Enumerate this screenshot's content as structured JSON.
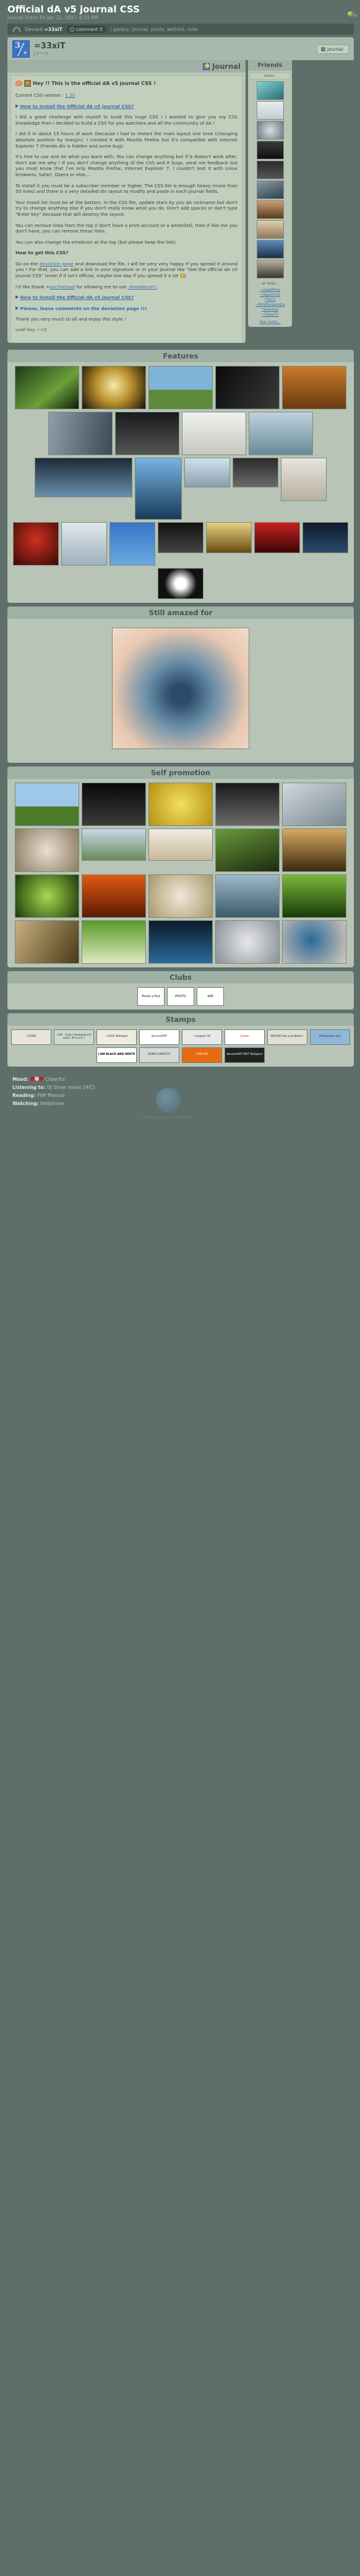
{
  "header": {
    "title": "Official dA v5 journal CSS",
    "subtitle": "Journal Entry: Fri Jan 12, 2007, 6:15 PM"
  },
  "nav": {
    "logo_icon": "deviantart-logo-icon",
    "deviant_label": "Deviant",
    "deviant_name": "=33xiT",
    "comment_label": "comment it",
    "comment_icon": "comment-icon",
    "separator": "|",
    "links": [
      "gallery",
      "journal",
      "prints",
      "wishlist",
      "note"
    ]
  },
  "user": {
    "avatar_icon": "user-avatar",
    "username": "=33xiT",
    "realname": "Joris",
    "button_label": "Journal",
    "button_icon": "journal-icon"
  },
  "journal": {
    "heading": "Journal",
    "heading_icon": "journal-write-icon",
    "greeting": "Hey !! This is the official dA v5 journal CSS !",
    "greeting_icons": [
      "emoticon-icon",
      "picture-frame-icon"
    ],
    "version_label": "Current CSS version :",
    "version_value": "1.20",
    "install_link": "How to install the Official dA v5 journal CSS?",
    "install_icon": "arrow-bullet-icon",
    "paragraphs": [
      "I did a great challenge with myself to build this huge CSS ! I wanted to give you my CSS knowledge then I decided to build a CSS for you watchers and all the community of dA !",
      "I did it in about 15 hours of work (because I had to restart the main layout one time (changing absolute position by margin), I created it with Mozilla Firefox but it's compatible with Internet Explorer 7 (friends div is hidden and some bug).",
      "It's free to use and do what you want with. You can change anything but if it doesn't work after, don't ask me why ! If you don't change anything of the CSS and it bugs, send me feedback but you must know that I've only Mozilla Firefox, Internet Explorer 7. I couldn't test it with Linux browsers, Safari, Opera or else...",
      "To install it you must be a subscriber member or higher. The CSS file is enough heavy (more than 50 lines) and there is a very detailed div layout to modify and paste in each journal fields.",
      "Your mood list must be at the bottom. In the CSS file, update stars by you dA nickname but don't try to change anything else if you don't really know what you do. Don't add spaces or don't type \"Enter key\" because that will destroy the layout.",
      "You can remove links from the top (I don't have a print account or a whishlist), then if like me you don't have, you can remove these links.",
      "You can also change the emoticon at the top (but please keep the link)."
    ],
    "howto_heading": "How to get this CSS?",
    "howto_text_1": "Go on the",
    "howto_link_1": "deviation page",
    "howto_text_2": "and download the file. I will be very very happy if you spread it around you ! For that, you can add a link in your signature or in your journal like \"Get the official dA v5 journal CSS\" (even if it isn't official, maybe one day if you spread it a lot",
    "howto_text_3": ").",
    "thanks_1": "I'd like thank =",
    "thanks_link_1": "zacthetoad",
    "thanks_2": "for allowing me to use",
    "thanks_link_2": ":ilovedevart:",
    "thanks_3": ".",
    "install_link_2": "How to install the Official dA v5 journal CSS?",
    "please_comment": "Please, leave comments on the deviation page !!!",
    "thank_you": "Thank you very much to all and enjoy this style !",
    "signature": "LeaF-boy ~<3"
  },
  "friends": {
    "heading": "Friends",
    "zoom_label": "zoom :",
    "links_title": "or links :",
    "links": [
      "~superhey",
      "~dspencre",
      "*Tetry",
      "~MrsMorgandia",
      "*anemes",
      "~Dess73"
    ],
    "see_more": "See more..."
  },
  "sections": [
    {
      "id": "features",
      "title": "Features"
    },
    {
      "id": "still-amazed",
      "title": "Still amazed for"
    },
    {
      "id": "self-promotion",
      "title": "Self promotion"
    },
    {
      "id": "clubs",
      "title": "Clubs"
    },
    {
      "id": "stamps",
      "title": "Stamps"
    }
  ],
  "clubs": [
    {
      "label": "Photo a Hut"
    },
    {
      "label": "PHOTO"
    },
    {
      "label": "dAP"
    }
  ],
  "stamps": [
    "I CODE",
    "CSS - Club ( background color: #cccccc )",
    "I LOVE Notepad",
    "deviantART",
    "I support dA",
    "Canon",
    "MACRO has a problem !",
    "Photoshop user",
    "I AM BLACK AND WHITE",
    "DEMO CONTEST",
    "FIREFOX",
    "deviantART NOT MySpace"
  ],
  "footer": {
    "mood_label": "Mood:",
    "mood_value": "Cheerful",
    "mood_icon": "mood-cheerful-icon",
    "listening_label": "Listening to:",
    "listening_value": "DJ Silver mixes (H/C)",
    "reading_label": "Reading:",
    "reading_value": "PHP Manual",
    "watching_label": "Watching:",
    "watching_value": "Hellphone",
    "firefox_note": "Best viewed in FIREFOX",
    "firefox_icon": "firefox-icon"
  }
}
